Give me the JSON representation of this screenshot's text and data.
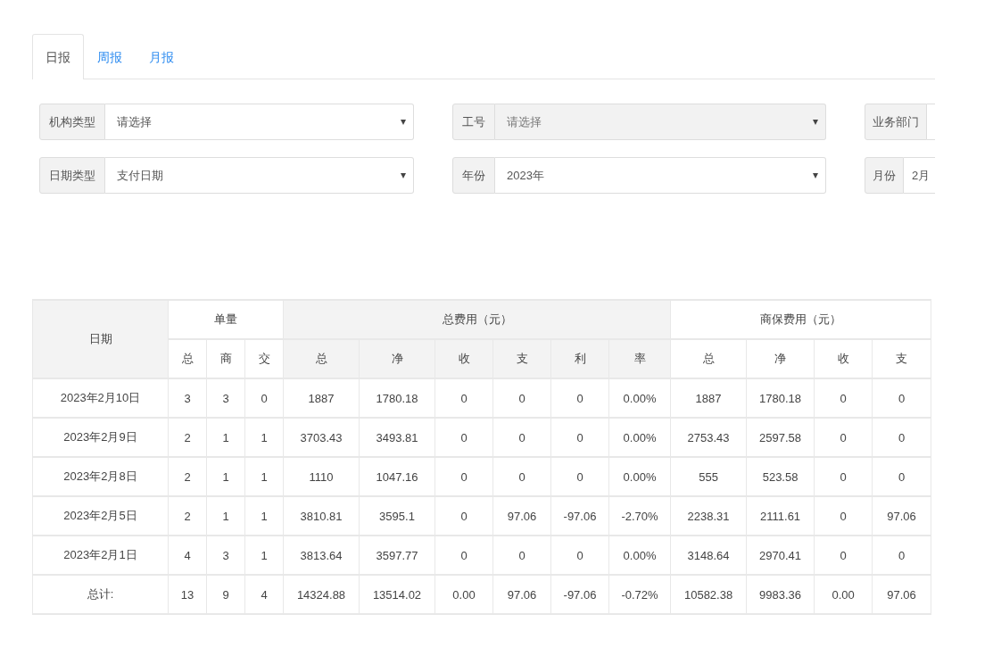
{
  "tabs": [
    {
      "label": "日报",
      "selected": true
    },
    {
      "label": "周报",
      "selected": false
    },
    {
      "label": "月报",
      "selected": false
    }
  ],
  "filters": [
    [
      {
        "label": "机构类型",
        "value": "请选择",
        "disabled": false
      },
      {
        "label": "工号",
        "value": "请选择",
        "disabled": true
      },
      {
        "label": "业务部门",
        "disabled": false
      }
    ],
    [
      {
        "label": "日期类型",
        "value": "支付日期",
        "disabled": false
      },
      {
        "label": "年份",
        "value": "2023年",
        "disabled": false
      },
      {
        "label": "月份",
        "value": "2月",
        "disabled": false
      }
    ]
  ],
  "table": {
    "date_header": "日期",
    "groups": [
      {
        "label": "单量",
        "columns": [
          "总",
          "商",
          "交"
        ]
      },
      {
        "label": "总费用（元）",
        "columns": [
          "总",
          "净",
          "收",
          "支",
          "利",
          "率"
        ]
      },
      {
        "label": "商保费用（元）",
        "columns": [
          "总",
          "净",
          "收",
          "支"
        ]
      }
    ],
    "rows": [
      {
        "date": "2023年2月10日",
        "cells": [
          "3",
          "3",
          "0",
          "1887",
          "1780.18",
          "0",
          "0",
          "0",
          "0.00%",
          "1887",
          "1780.18",
          "0",
          "0"
        ]
      },
      {
        "date": "2023年2月9日",
        "cells": [
          "2",
          "1",
          "1",
          "3703.43",
          "3493.81",
          "0",
          "0",
          "0",
          "0.00%",
          "2753.43",
          "2597.58",
          "0",
          "0"
        ]
      },
      {
        "date": "2023年2月8日",
        "cells": [
          "2",
          "1",
          "1",
          "1110",
          "1047.16",
          "0",
          "0",
          "0",
          "0.00%",
          "555",
          "523.58",
          "0",
          "0"
        ]
      },
      {
        "date": "2023年2月5日",
        "cells": [
          "2",
          "1",
          "1",
          "3810.81",
          "3595.1",
          "0",
          "97.06",
          "-97.06",
          "-2.70%",
          "2238.31",
          "2111.61",
          "0",
          "97.06"
        ]
      },
      {
        "date": "2023年2月1日",
        "cells": [
          "4",
          "3",
          "1",
          "3813.64",
          "3597.77",
          "0",
          "0",
          "0",
          "0.00%",
          "3148.64",
          "2970.41",
          "0",
          "0"
        ]
      },
      {
        "date": "总计:",
        "cells": [
          "13",
          "9",
          "4",
          "14324.88",
          "13514.02",
          "0.00",
          "97.06",
          "-97.06",
          "-0.72%",
          "10582.38",
          "9983.36",
          "0.00",
          "97.06"
        ]
      }
    ]
  }
}
